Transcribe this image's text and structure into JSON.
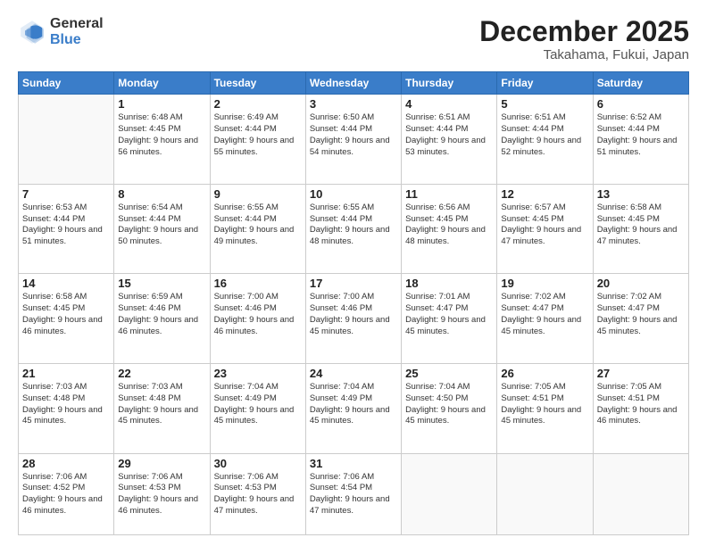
{
  "logo": {
    "general": "General",
    "blue": "Blue"
  },
  "header": {
    "month": "December 2025",
    "location": "Takahama, Fukui, Japan"
  },
  "weekdays": [
    "Sunday",
    "Monday",
    "Tuesday",
    "Wednesday",
    "Thursday",
    "Friday",
    "Saturday"
  ],
  "weeks": [
    [
      {
        "day": "",
        "info": ""
      },
      {
        "day": "1",
        "info": "Sunrise: 6:48 AM\nSunset: 4:45 PM\nDaylight: 9 hours\nand 56 minutes."
      },
      {
        "day": "2",
        "info": "Sunrise: 6:49 AM\nSunset: 4:44 PM\nDaylight: 9 hours\nand 55 minutes."
      },
      {
        "day": "3",
        "info": "Sunrise: 6:50 AM\nSunset: 4:44 PM\nDaylight: 9 hours\nand 54 minutes."
      },
      {
        "day": "4",
        "info": "Sunrise: 6:51 AM\nSunset: 4:44 PM\nDaylight: 9 hours\nand 53 minutes."
      },
      {
        "day": "5",
        "info": "Sunrise: 6:51 AM\nSunset: 4:44 PM\nDaylight: 9 hours\nand 52 minutes."
      },
      {
        "day": "6",
        "info": "Sunrise: 6:52 AM\nSunset: 4:44 PM\nDaylight: 9 hours\nand 51 minutes."
      }
    ],
    [
      {
        "day": "7",
        "info": "Sunrise: 6:53 AM\nSunset: 4:44 PM\nDaylight: 9 hours\nand 51 minutes."
      },
      {
        "day": "8",
        "info": "Sunrise: 6:54 AM\nSunset: 4:44 PM\nDaylight: 9 hours\nand 50 minutes."
      },
      {
        "day": "9",
        "info": "Sunrise: 6:55 AM\nSunset: 4:44 PM\nDaylight: 9 hours\nand 49 minutes."
      },
      {
        "day": "10",
        "info": "Sunrise: 6:55 AM\nSunset: 4:44 PM\nDaylight: 9 hours\nand 48 minutes."
      },
      {
        "day": "11",
        "info": "Sunrise: 6:56 AM\nSunset: 4:45 PM\nDaylight: 9 hours\nand 48 minutes."
      },
      {
        "day": "12",
        "info": "Sunrise: 6:57 AM\nSunset: 4:45 PM\nDaylight: 9 hours\nand 47 minutes."
      },
      {
        "day": "13",
        "info": "Sunrise: 6:58 AM\nSunset: 4:45 PM\nDaylight: 9 hours\nand 47 minutes."
      }
    ],
    [
      {
        "day": "14",
        "info": "Sunrise: 6:58 AM\nSunset: 4:45 PM\nDaylight: 9 hours\nand 46 minutes."
      },
      {
        "day": "15",
        "info": "Sunrise: 6:59 AM\nSunset: 4:46 PM\nDaylight: 9 hours\nand 46 minutes."
      },
      {
        "day": "16",
        "info": "Sunrise: 7:00 AM\nSunset: 4:46 PM\nDaylight: 9 hours\nand 46 minutes."
      },
      {
        "day": "17",
        "info": "Sunrise: 7:00 AM\nSunset: 4:46 PM\nDaylight: 9 hours\nand 45 minutes."
      },
      {
        "day": "18",
        "info": "Sunrise: 7:01 AM\nSunset: 4:47 PM\nDaylight: 9 hours\nand 45 minutes."
      },
      {
        "day": "19",
        "info": "Sunrise: 7:02 AM\nSunset: 4:47 PM\nDaylight: 9 hours\nand 45 minutes."
      },
      {
        "day": "20",
        "info": "Sunrise: 7:02 AM\nSunset: 4:47 PM\nDaylight: 9 hours\nand 45 minutes."
      }
    ],
    [
      {
        "day": "21",
        "info": "Sunrise: 7:03 AM\nSunset: 4:48 PM\nDaylight: 9 hours\nand 45 minutes."
      },
      {
        "day": "22",
        "info": "Sunrise: 7:03 AM\nSunset: 4:48 PM\nDaylight: 9 hours\nand 45 minutes."
      },
      {
        "day": "23",
        "info": "Sunrise: 7:04 AM\nSunset: 4:49 PM\nDaylight: 9 hours\nand 45 minutes."
      },
      {
        "day": "24",
        "info": "Sunrise: 7:04 AM\nSunset: 4:49 PM\nDaylight: 9 hours\nand 45 minutes."
      },
      {
        "day": "25",
        "info": "Sunrise: 7:04 AM\nSunset: 4:50 PM\nDaylight: 9 hours\nand 45 minutes."
      },
      {
        "day": "26",
        "info": "Sunrise: 7:05 AM\nSunset: 4:51 PM\nDaylight: 9 hours\nand 45 minutes."
      },
      {
        "day": "27",
        "info": "Sunrise: 7:05 AM\nSunset: 4:51 PM\nDaylight: 9 hours\nand 46 minutes."
      }
    ],
    [
      {
        "day": "28",
        "info": "Sunrise: 7:06 AM\nSunset: 4:52 PM\nDaylight: 9 hours\nand 46 minutes."
      },
      {
        "day": "29",
        "info": "Sunrise: 7:06 AM\nSunset: 4:53 PM\nDaylight: 9 hours\nand 46 minutes."
      },
      {
        "day": "30",
        "info": "Sunrise: 7:06 AM\nSunset: 4:53 PM\nDaylight: 9 hours\nand 47 minutes."
      },
      {
        "day": "31",
        "info": "Sunrise: 7:06 AM\nSunset: 4:54 PM\nDaylight: 9 hours\nand 47 minutes."
      },
      {
        "day": "",
        "info": ""
      },
      {
        "day": "",
        "info": ""
      },
      {
        "day": "",
        "info": ""
      }
    ]
  ]
}
